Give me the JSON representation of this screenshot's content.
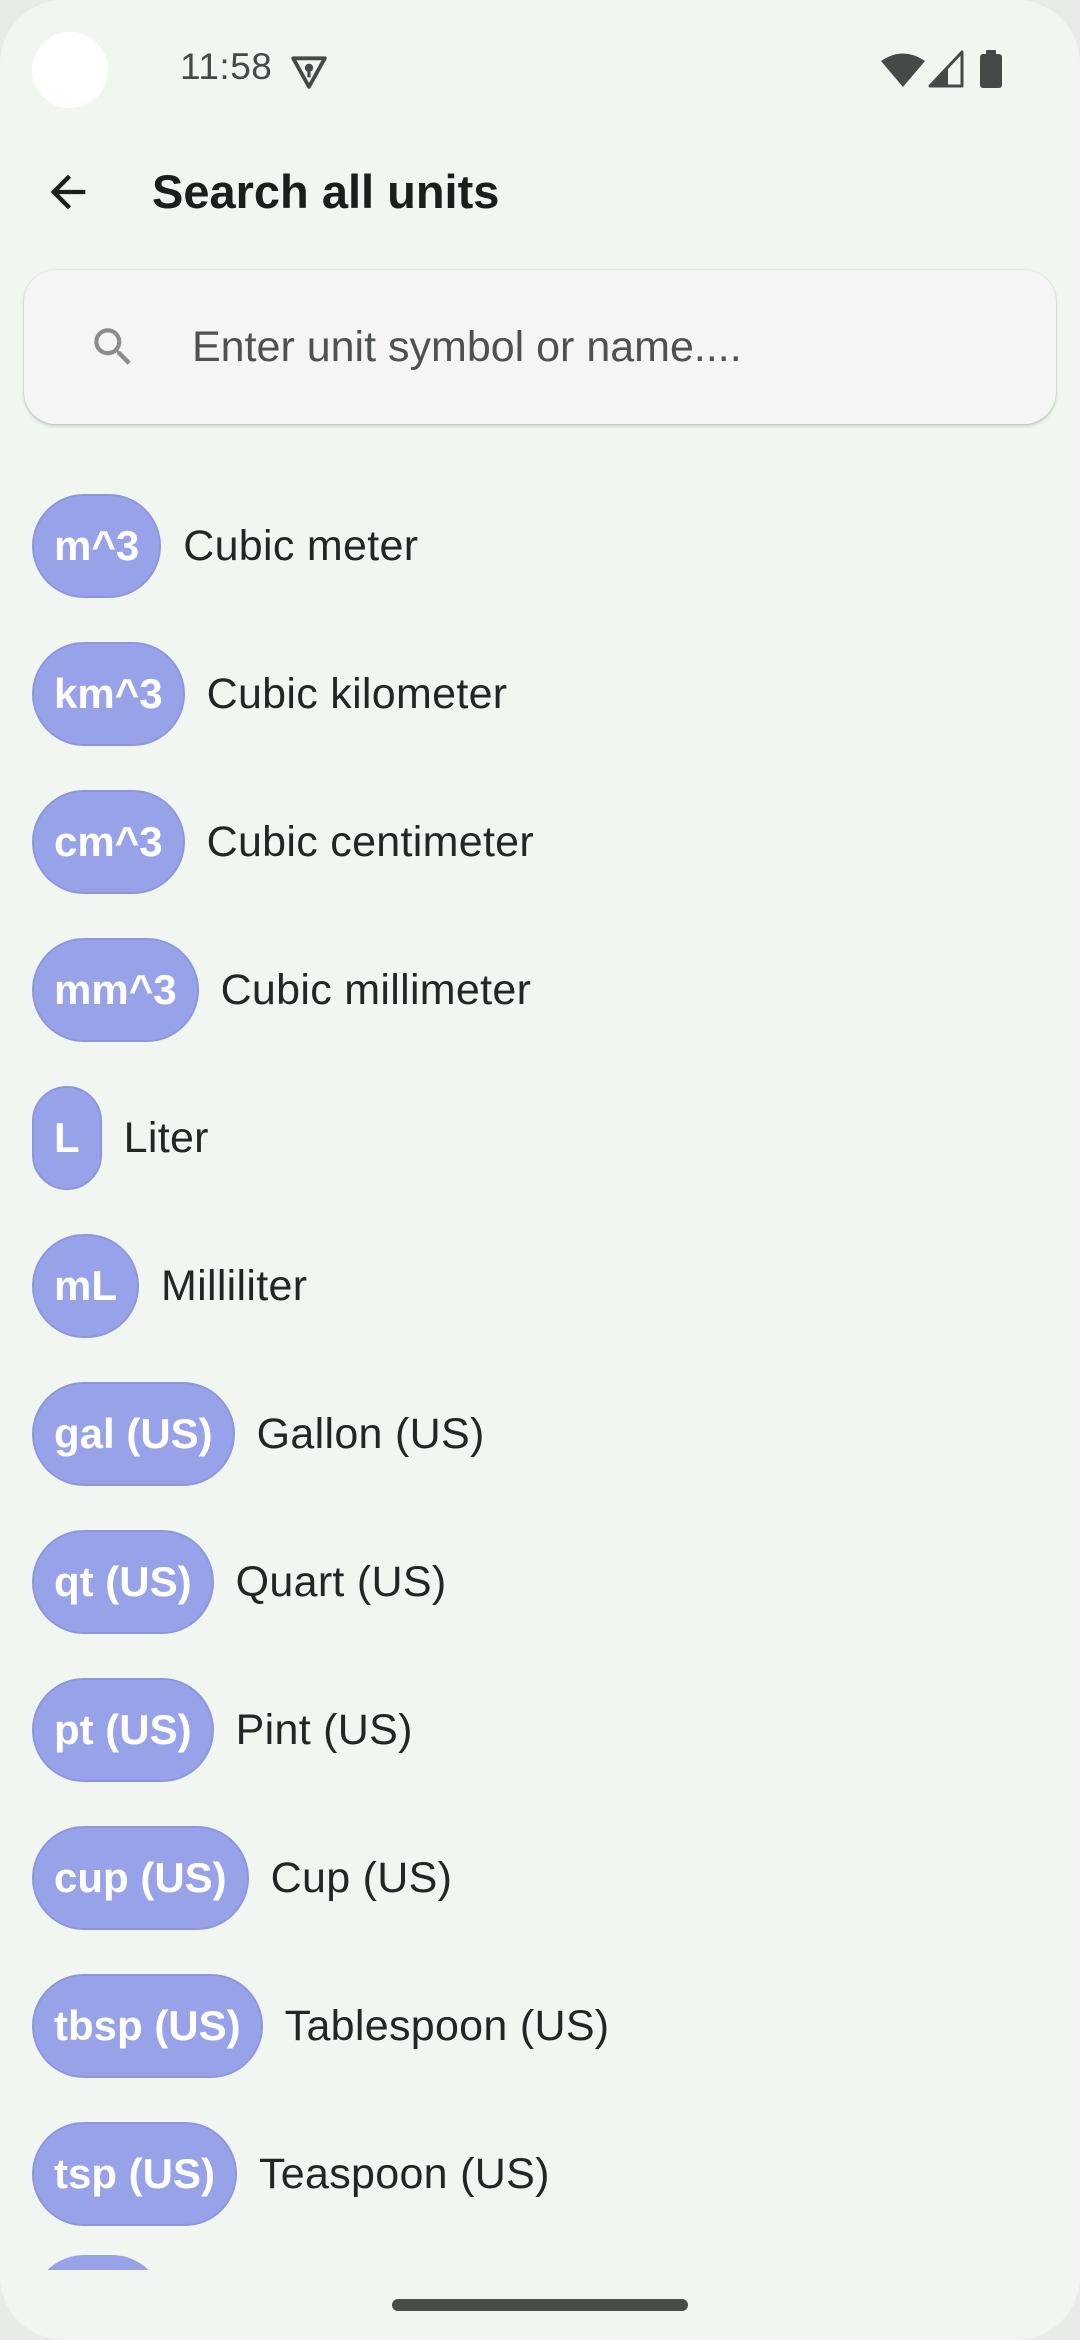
{
  "status_bar": {
    "time": "11:58",
    "icons": [
      "vpn-key-icon",
      "wifi-icon",
      "signal-icon",
      "battery-icon"
    ]
  },
  "app_bar": {
    "back_icon": "arrow-back-icon",
    "title": "Search all units"
  },
  "search": {
    "icon": "search-icon",
    "placeholder": "Enter unit symbol or name....",
    "value": ""
  },
  "units": [
    {
      "symbol": "m^3",
      "name": "Cubic meter"
    },
    {
      "symbol": "km^3",
      "name": "Cubic kilometer"
    },
    {
      "symbol": "cm^3",
      "name": "Cubic centimeter"
    },
    {
      "symbol": "mm^3",
      "name": "Cubic millimeter"
    },
    {
      "symbol": "L",
      "name": "Liter"
    },
    {
      "symbol": "mL",
      "name": "Milliliter"
    },
    {
      "symbol": "gal (US)",
      "name": "Gallon (US)"
    },
    {
      "symbol": "qt (US)",
      "name": "Quart (US)"
    },
    {
      "symbol": "pt (US)",
      "name": "Pint (US)"
    },
    {
      "symbol": "cup (US)",
      "name": "Cup (US)"
    },
    {
      "symbol": "tbsp (US)",
      "name": "Tablespoon (US)"
    },
    {
      "symbol": "tsp (US)",
      "name": "Teaspoon (US)"
    }
  ],
  "colors": {
    "background": "#f1f6f1",
    "chip": "#97a2e8",
    "chip_text": "#ffffff",
    "search_field": "#f5f5f5"
  }
}
